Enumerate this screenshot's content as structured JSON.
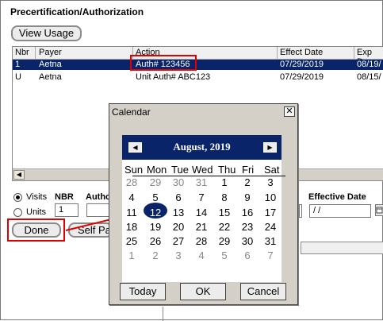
{
  "window": {
    "title": "Precertification/Authorization"
  },
  "toolbar": {
    "view_usage_label": "View Usage"
  },
  "table": {
    "columns": [
      "Nbr",
      "Payer",
      "Action",
      "Effect Date",
      "Exp Da"
    ],
    "rows": [
      {
        "nbr": "1",
        "payer": "Aetna",
        "action": "Auth# 123456",
        "effect_date": "07/29/2019",
        "exp_date": "08/19/",
        "selected": true
      },
      {
        "nbr": "U",
        "payer": "Aetna",
        "action": "Unit Auth# ABC123",
        "effect_date": "07/29/2019",
        "exp_date": "08/15/",
        "selected": false
      }
    ]
  },
  "form": {
    "visits_label": "Visits",
    "units_label": "Units",
    "nbr_label": "NBR",
    "nbr_value": "1",
    "auth_label": "Autho",
    "effective_date_label": "Effective Date",
    "effective_date_value": " / /",
    "done_label": "Done",
    "self_pay_label": "Self Pa"
  },
  "calendar": {
    "title": "Calendar",
    "close_glyph": "✕",
    "month_label": "August, 2019",
    "prev_glyph": "◀",
    "next_glyph": "▶",
    "weekdays": [
      "Sun",
      "Mon",
      "Tue",
      "Wed",
      "Thu",
      "Fri",
      "Sat"
    ],
    "weeks": [
      [
        "28",
        "29",
        "30",
        "31",
        "1",
        "2",
        "3"
      ],
      [
        "4",
        "5",
        "6",
        "7",
        "8",
        "9",
        "10"
      ],
      [
        "11",
        "12",
        "13",
        "14",
        "15",
        "16",
        "17"
      ],
      [
        "18",
        "19",
        "20",
        "21",
        "22",
        "23",
        "24"
      ],
      [
        "25",
        "26",
        "27",
        "28",
        "29",
        "30",
        "31"
      ],
      [
        "1",
        "2",
        "3",
        "4",
        "5",
        "6",
        "7"
      ]
    ],
    "selected_day": "12",
    "today_label": "Today",
    "ok_label": "OK",
    "cancel_label": "Cancel"
  },
  "colors": {
    "selection": "#0a246a",
    "highlight_box": "#e00000"
  },
  "icons": {
    "calendar_button": "calendar-icon"
  }
}
